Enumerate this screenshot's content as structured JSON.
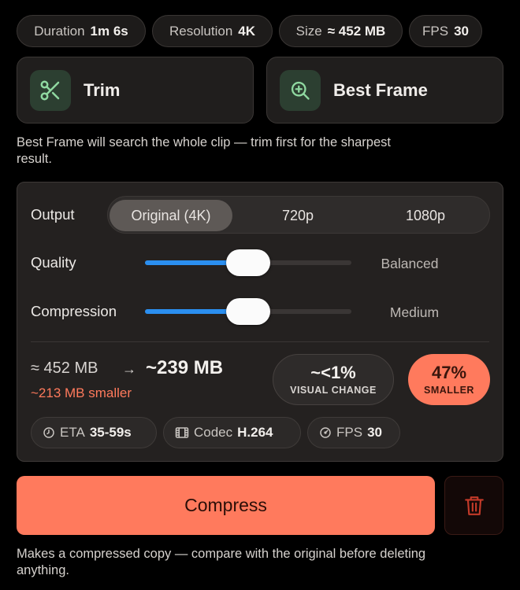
{
  "info_pills": [
    {
      "label": "Duration",
      "value": "1m 6s"
    },
    {
      "label": "Resolution",
      "value": "4K"
    },
    {
      "label": "Size",
      "value": "≈ 452 MB"
    },
    {
      "label": "FPS",
      "value": "30"
    }
  ],
  "actions": {
    "trim_label": "Trim",
    "trim_icon": "scissors-icon",
    "best_frame_label": "Best Frame",
    "best_frame_icon": "zoom-in-icon"
  },
  "hint": "Best Frame will search the whole clip — trim first for the sharpest result.",
  "settings": {
    "output_label": "Output",
    "output_options": [
      "Original (4K)",
      "720p",
      "1080p"
    ],
    "output_selected": "Original (4K)",
    "quality_label": "Quality",
    "quality_value": "Balanced",
    "quality_level": 0.47,
    "compression_label": "Compression",
    "compression_value": "Medium",
    "compression_level": 0.47
  },
  "estimate": {
    "from": "≈ 452 MB",
    "arrow": "→",
    "to": "~239 MB",
    "delta": "~213 MB smaller",
    "visual_value": "~<1%",
    "visual_label": "VISUAL CHANGE",
    "percent_value": "47%",
    "percent_label": "SMALLER"
  },
  "chips": [
    {
      "icon": "clock-icon",
      "label": "ETA",
      "value": "35-59s"
    },
    {
      "icon": "film-icon",
      "label": "Codec",
      "value": "H.264"
    },
    {
      "icon": "gauge-icon",
      "label": "FPS",
      "value": "30"
    }
  ],
  "compress_label": "Compress",
  "delete_icon": "trash-icon",
  "footer_note": "Makes a compressed copy — compare with the original before deleting anything.",
  "colors": {
    "accent": "#ff7a5d",
    "slider": "#2b8ff0",
    "icon_tile": "#2c3f31",
    "icon_glyph": "#8fd8a0"
  }
}
